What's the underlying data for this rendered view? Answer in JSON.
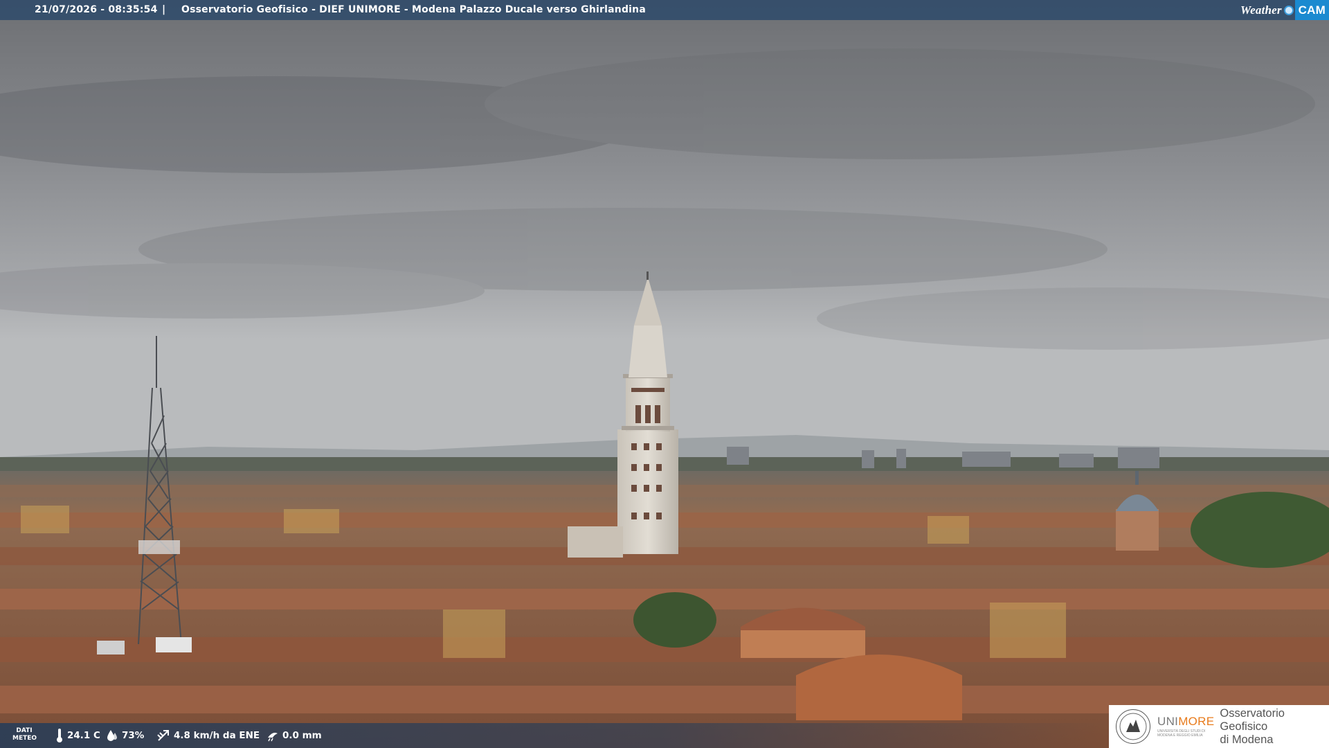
{
  "overlay": {
    "timestamp": "21/07/2026 - 08:35:54",
    "separator": "|",
    "location": "Osservatorio Geofisico - DIEF UNIMORE - Modena Palazzo Ducale verso Ghirlandina"
  },
  "brand_logo": {
    "word": "Weather",
    "cam": "CAM",
    "accent": "#1b8ad0"
  },
  "weather": {
    "label_line1": "DATI",
    "label_line2": "METEO",
    "temperature": "24.1 C",
    "humidity": "73%",
    "wind": "4.8 km/h da ENE",
    "rain": "0.0 mm",
    "icons": [
      "thermometer-icon",
      "humidity-drop-icon",
      "wind-vane-icon",
      "rain-gauge-icon"
    ]
  },
  "institution": {
    "name_part1": "UNI",
    "name_part2": "MORE",
    "subtitle": "UNIVERSITÀ DEGLI STUDI DI MODENA E REGGIO EMILIA",
    "observatory_line1": "Osservatorio Geofisico",
    "observatory_line2": "di Modena",
    "accent": "#e87b1c"
  },
  "scene": {
    "description_colors": {
      "sky": "#8c8e91",
      "roofs": "#9a6a4e",
      "tower": "#d8d2c8"
    }
  }
}
